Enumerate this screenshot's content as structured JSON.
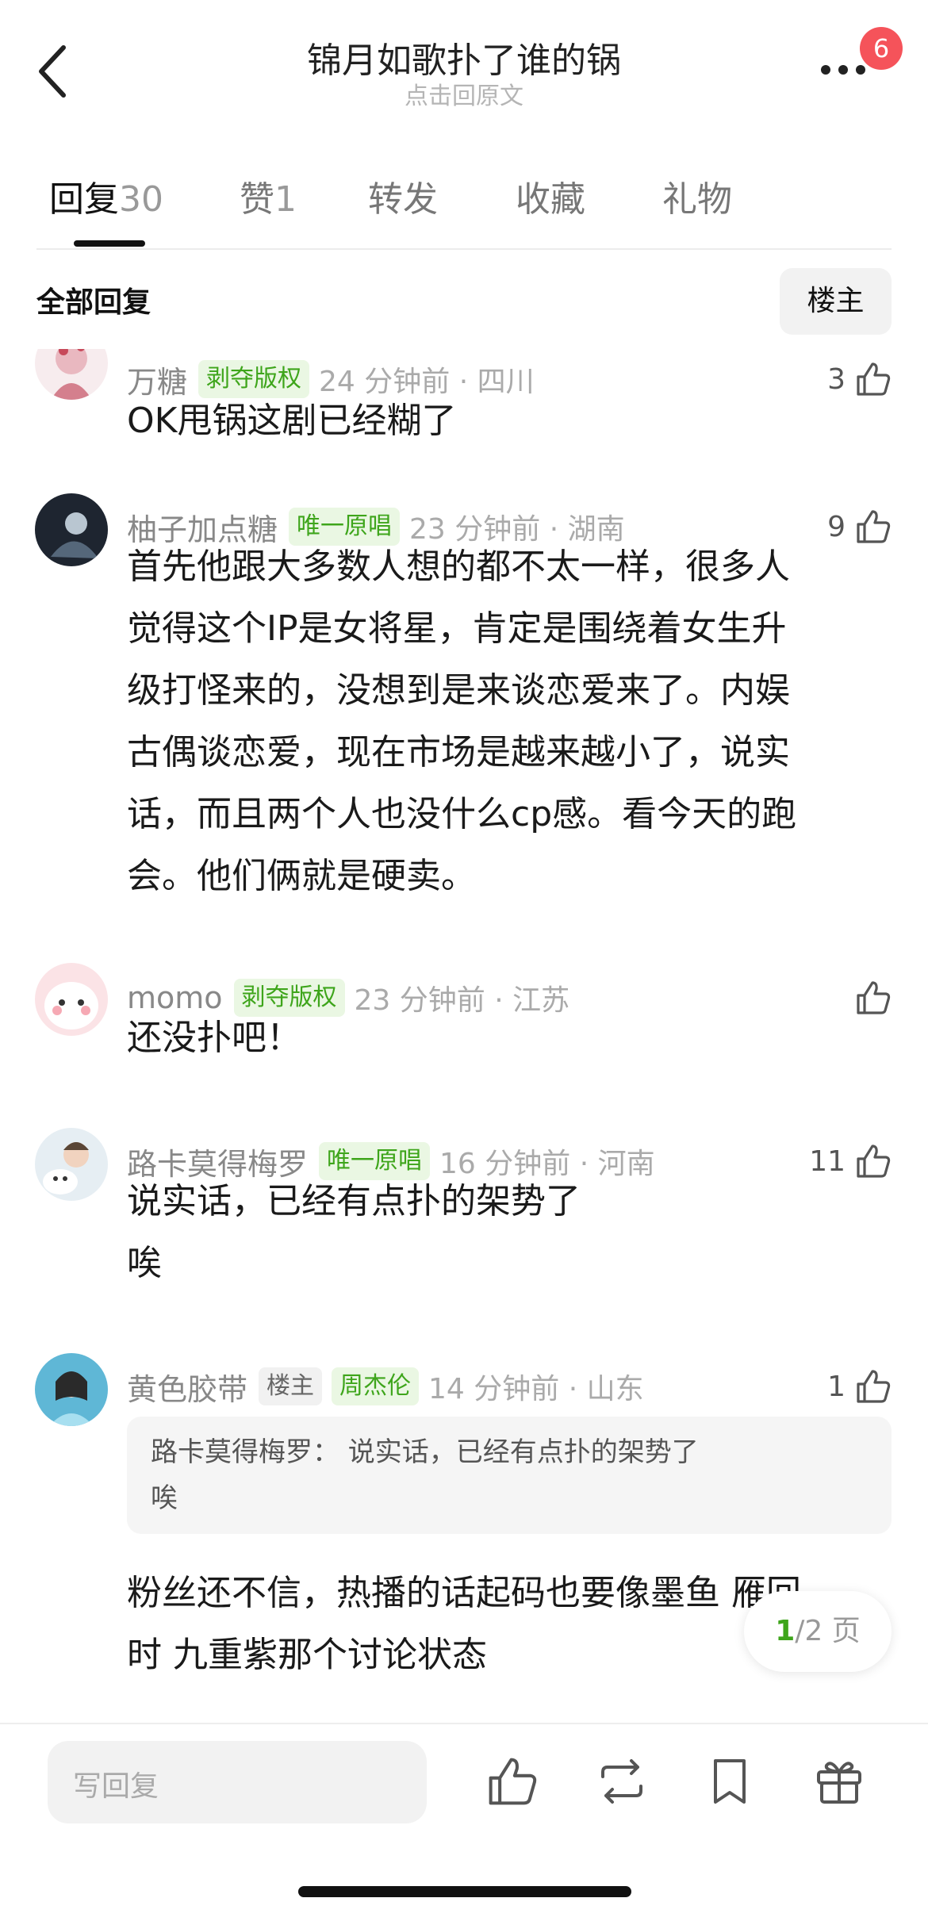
{
  "header": {
    "title": "锦月如歌扑了谁的锅",
    "subtitle": "点击回原文",
    "badge_count": "6"
  },
  "tabs": [
    {
      "label": "回复",
      "count": "30",
      "active": true
    },
    {
      "label": "赞",
      "count": "1",
      "active": false
    },
    {
      "label": "转发",
      "count": "",
      "active": false
    },
    {
      "label": "收藏",
      "count": "",
      "active": false
    },
    {
      "label": "礼物",
      "count": "",
      "active": false
    }
  ],
  "filter": {
    "all_replies": "全部回复",
    "owner_only": "楼主"
  },
  "comments": [
    {
      "name": "万糖",
      "tags": [
        "剥夺版权"
      ],
      "time": "24 分钟前 · 四川",
      "likes": "3",
      "text": "OK甩锅这剧已经糊了"
    },
    {
      "name": "柚子加点糖",
      "tags": [
        "唯一原唱"
      ],
      "time": "23 分钟前 · 湖南",
      "likes": "9",
      "text_lines": [
        "首先他跟大多数人想的都不太一样，很多人",
        "觉得这个IP是女将星，肯定是围绕着女生升",
        "级打怪来的，没想到是来谈恋爱来了。内娱",
        "古偶谈恋爱，现在市场是越来越小了，说实",
        "话，而且两个人也没什么cp感。看今天的跑",
        "会。他们俩就是硬卖。"
      ]
    },
    {
      "name": "momo",
      "tags": [
        "剥夺版权"
      ],
      "time": "23 分钟前 · 江苏",
      "likes": "",
      "text": "还没扑吧！"
    },
    {
      "name": "路卡莫得梅罗",
      "tags": [
        "唯一原唱"
      ],
      "time": "16 分钟前 · 河南",
      "likes": "11",
      "text_lines": [
        "说实话，已经有点扑的架势了",
        "唉"
      ]
    },
    {
      "name": "黄色胶带",
      "owner_tag": "楼主",
      "tags": [
        "周杰伦"
      ],
      "time": "14 分钟前 · 山东",
      "likes": "1",
      "quote_lines": [
        "路卡莫得梅罗：  说实话，已经有点扑的架势了",
        "唉"
      ],
      "text_lines": [
        "粉丝还不信，热播的话起码也要像墨鱼 雁回",
        "时 九重紫那个讨论状态"
      ]
    }
  ],
  "pager": {
    "current": "1",
    "total": "/2 页"
  },
  "bottom_bar": {
    "reply_placeholder": "写回复",
    "icons": [
      "like-icon",
      "repost-icon",
      "bookmark-icon",
      "gift-icon"
    ]
  },
  "colors": {
    "accent_green": "#3ea51b",
    "tag_green_bg": "#eaf7e3",
    "badge_red": "#f5535a"
  }
}
